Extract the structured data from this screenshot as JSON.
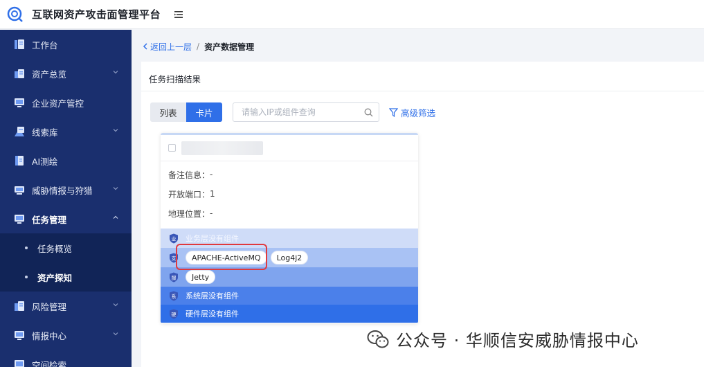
{
  "header": {
    "title": "互联网资产攻击面管理平台"
  },
  "colors": {
    "sidebar_bg": "#1a2f6e",
    "accent": "#2f6fe8",
    "highlight": "#e0393e"
  },
  "sidebar": {
    "items": [
      {
        "label": "工作台",
        "icon": "dashboard-icon",
        "expandable": false
      },
      {
        "label": "资产总览",
        "icon": "assets-icon",
        "expandable": true
      },
      {
        "label": "企业资产管控",
        "icon": "monitor-icon",
        "expandable": false
      },
      {
        "label": "线索库",
        "icon": "clue-icon",
        "expandable": true
      },
      {
        "label": "AI测绘",
        "icon": "doc-icon",
        "expandable": false
      },
      {
        "label": "威胁情报与狩猎",
        "icon": "threat-icon",
        "expandable": true
      },
      {
        "label": "任务管理",
        "icon": "task-icon",
        "expandable": true,
        "expanded": true
      },
      {
        "label": "风险管理",
        "icon": "risk-icon",
        "expandable": true
      },
      {
        "label": "情报中心",
        "icon": "intel-icon",
        "expandable": true
      },
      {
        "label": "空间检索",
        "icon": "search-space-icon",
        "expandable": false
      }
    ],
    "sub_items": [
      {
        "label": "任务概览"
      },
      {
        "label": "资产探知",
        "selected": true
      }
    ]
  },
  "breadcrumb": {
    "back": "返回上一层",
    "separator": "/",
    "current": "资产数据管理"
  },
  "panel": {
    "title": "任务扫描结果",
    "view_toggle": {
      "list": "列表",
      "card": "卡片",
      "active": "卡片"
    },
    "search": {
      "placeholder": "请输入IP或组件查询",
      "value": ""
    },
    "advanced_filter": "高级筛选"
  },
  "card": {
    "info": [
      {
        "label": "备注信息：",
        "value": "-"
      },
      {
        "label": "开放端口：",
        "value": "1"
      },
      {
        "label": "地理位置：",
        "value": "-"
      }
    ],
    "layers": [
      {
        "shield_char": "业",
        "text": "业务层没有组件",
        "tags": []
      },
      {
        "shield_char": "支",
        "text": "",
        "tags": [
          "APACHE-ActiveMQ",
          "Log4j2"
        ]
      },
      {
        "shield_char": "服",
        "text": "",
        "tags": [
          "Jetty"
        ]
      },
      {
        "shield_char": "系",
        "text": "系统层没有组件",
        "tags": []
      },
      {
        "shield_char": "硬",
        "text": "硬件层没有组件",
        "tags": []
      }
    ]
  },
  "watermark": {
    "text": "公众号 · 华顺信安威胁情报中心"
  }
}
